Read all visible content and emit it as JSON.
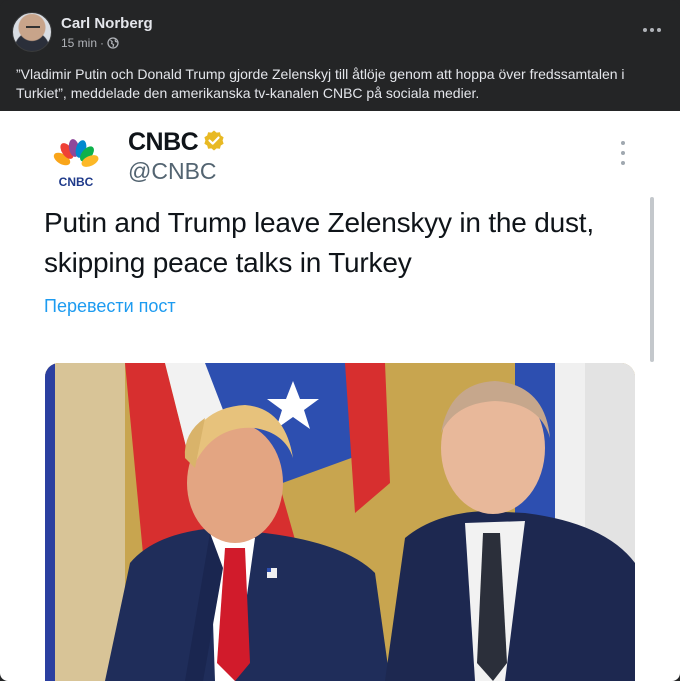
{
  "post": {
    "author": "Carl Norberg",
    "time": "15 min",
    "separator": "·",
    "text": "”Vladimir Putin och Donald Trump gjorde Zelenskyj till åtlöje genom att hoppa över fredssamtalen i Turkiet”, meddelade den amerikanska tv-kanalen CNBC på sociala medier."
  },
  "tweet": {
    "logo_text": "CNBC",
    "name": "CNBC",
    "handle": "@CNBC",
    "text": "Putin and Trump leave Zelenskyy in the dust, skipping peace talks in Turkey",
    "translate": "Перевести пост"
  },
  "colors": {
    "background": "#242526",
    "link": "#1d9bf0",
    "verified": "#e8b923"
  },
  "icons": {
    "globe": "globe-icon",
    "more": "more-options-icon",
    "verified": "verified-badge-icon"
  }
}
